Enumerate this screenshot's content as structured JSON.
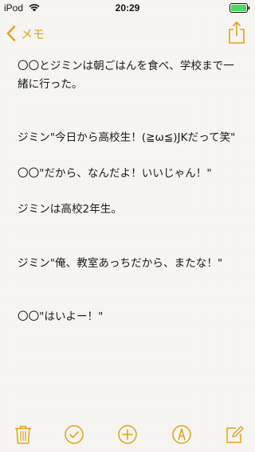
{
  "colors": {
    "accent": "#e0a31a",
    "battery": "#4cd964"
  },
  "status_bar": {
    "carrier": "iPod",
    "time": "20:29",
    "wifi_icon": "wifi-icon",
    "battery_icon": "battery-full-icon"
  },
  "nav": {
    "back_label": "メモ",
    "back_icon": "chevron-left-icon",
    "share_icon": "share-icon"
  },
  "note": {
    "lines": [
      "〇〇とジミンは朝ごはんを食べ、学校まで一緒に行った。",
      "",
      "",
      "ジミン\"今日から高校生！(≧ω≦)JKだって笑\"",
      "",
      "〇〇\"だから、なんだよ！いいじゃん！\"",
      "",
      "ジミンは高校2年生。",
      "",
      "",
      "ジミン\"俺、教室あっちだから、またな！\"",
      "",
      "",
      "〇〇\"はいよー！\""
    ]
  },
  "toolbar": {
    "items": [
      "trash-icon",
      "checklist-icon",
      "add-icon",
      "markup-icon",
      "compose-icon"
    ]
  }
}
